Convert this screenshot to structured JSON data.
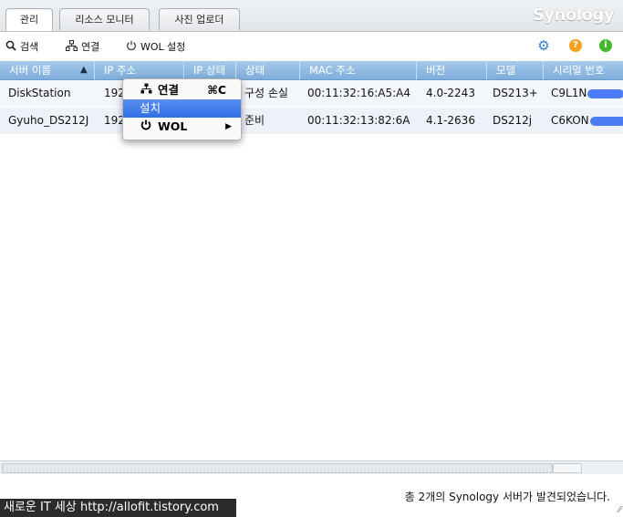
{
  "tabs": [
    {
      "label": "관리"
    },
    {
      "label": "리소스 모니터"
    },
    {
      "label": "사진 업로더"
    }
  ],
  "brand": "Synology",
  "toolbar": {
    "search_label": "검색",
    "connect_label": "연결",
    "wol_label": "WOL 설정"
  },
  "icons": {
    "search": "search-icon",
    "connect": "network-icon",
    "wol": "power-icon",
    "settings": "gear-icon",
    "help": "help-icon",
    "info": "info-icon"
  },
  "colors": {
    "header_blue": "#7eaedb",
    "selection_blue": "#2f6ee6",
    "help_orange": "#f3a21b",
    "info_green": "#41b82d",
    "settings_blue": "#2c7fd3"
  },
  "table": {
    "columns": [
      "서버 이름",
      "IP 주소",
      "IP 상태",
      "상태",
      "MAC 주소",
      "버전",
      "모델",
      "시리얼 번호"
    ],
    "sorted_column": "서버 이름",
    "sort_indicator": "▲",
    "rows": [
      {
        "name": "DiskStation",
        "ip": "192",
        "ip_status": "",
        "status": "구성 손실",
        "mac": "00:11:32:16:A5:A4",
        "version": "4.0-2243",
        "model": "DS213+",
        "serial": "C9L1N"
      },
      {
        "name": "Gyuho_DS212J",
        "ip": "192",
        "ip_status": "",
        "status": "준비",
        "mac": "00:11:32:13:82:6A",
        "version": "4.1-2636",
        "model": "DS212j",
        "serial": "C6KON"
      }
    ]
  },
  "context_menu": {
    "connect_label": "연결",
    "connect_shortcut": "⌘C",
    "install_label": "설치",
    "wol_label": "WOL",
    "submenu_arrow": "▶"
  },
  "status_bar": {
    "text": "총 2개의 Synology 서버가 발견되었습니다."
  },
  "watermark": "새로운 IT 세상 http://allofit.tistory.com"
}
